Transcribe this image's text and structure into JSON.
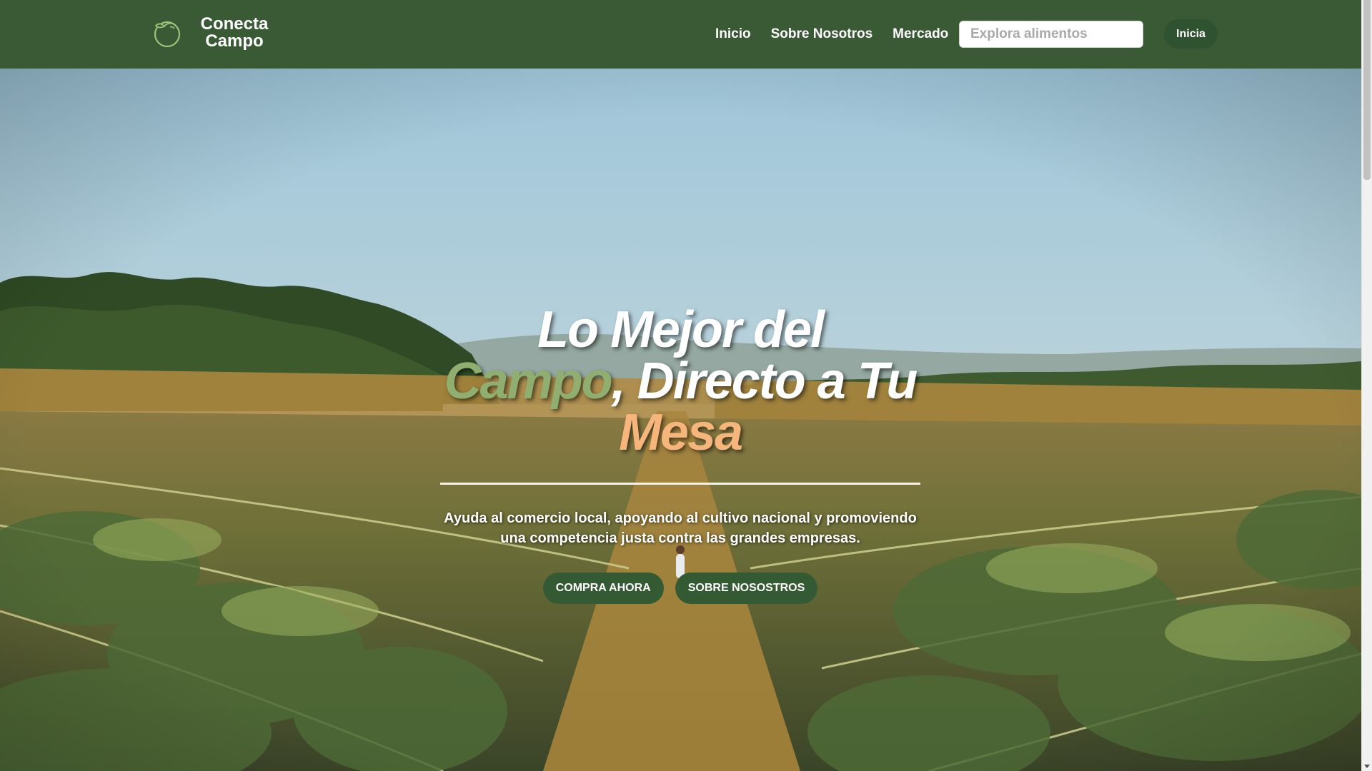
{
  "brand": {
    "name_line1": "Conecta",
    "name_line2": "Campo",
    "logo_icon": "tomato-leaf-icon"
  },
  "nav": {
    "links": [
      {
        "label": "Inicio"
      },
      {
        "label": "Sobre Nosotros"
      },
      {
        "label": "Mercado"
      }
    ],
    "search": {
      "placeholder": "Explora alimentos",
      "value": ""
    },
    "login_label": "Inicia"
  },
  "hero": {
    "title_line1": "Lo Mejor del",
    "title_highlight1": "Campo",
    "title_line2_rest": ", Directo a Tu",
    "title_highlight2": "Mesa",
    "subtitle": "Ayuda al comercio local, apoyando al cultivo nacional y promoviendo una competencia justa contra las grandes empresas.",
    "buttons": [
      {
        "label": "COMPRA AHORA"
      },
      {
        "label": "SOBRE NOSOSTROS"
      }
    ],
    "background": "dragon-fruit-field-photo"
  },
  "colors": {
    "navbar": "#3a5a36",
    "button": "#345a33",
    "highlight_green": "#8fae6f",
    "highlight_orange": "#f6b57a"
  }
}
